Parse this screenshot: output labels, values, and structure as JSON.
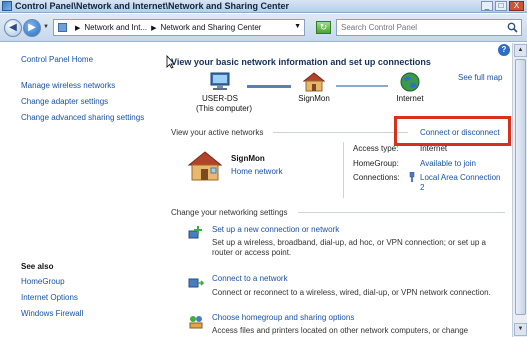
{
  "window": {
    "title": "Control Panel\\Network and Internet\\Network and Sharing Center",
    "buttons": {
      "minimize": "_",
      "maximize": "□",
      "close": "X"
    }
  },
  "address": {
    "crumbs": [
      "Network and Int...",
      "Network and Sharing Center"
    ],
    "search_placeholder": "Search Control Panel"
  },
  "sidebar": {
    "home": "Control Panel Home",
    "tasks": [
      "Manage wireless networks",
      "Change adapter settings",
      "Change advanced sharing settings"
    ],
    "see_also_header": "See also",
    "see_also": [
      "HomeGroup",
      "Internet Options",
      "Windows Firewall"
    ]
  },
  "main": {
    "heading": "View your basic network information and set up connections",
    "see_full_map": "See full map",
    "map_nodes": [
      {
        "name": "USER-DS",
        "sub": "(This computer)"
      },
      {
        "name": "SignMon",
        "sub": ""
      },
      {
        "name": "Internet",
        "sub": ""
      }
    ],
    "active_header": "View your active networks",
    "connect_disconnect": "Connect or disconnect",
    "network": {
      "name": "SignMon",
      "type": "Home network",
      "access_type_label": "Access type:",
      "access_type_value": "Internet",
      "homegroup_label": "HomeGroup:",
      "homegroup_value": "Available to join",
      "connections_label": "Connections:",
      "connections_value_1": "Local Area Connection",
      "connections_value_2": "2"
    },
    "change_header": "Change your networking settings",
    "tasks": [
      {
        "title": "Set up a new connection or network",
        "desc": "Set up a wireless, broadband, dial-up, ad hoc, or VPN connection; or set up a router or access point."
      },
      {
        "title": "Connect to a network",
        "desc": "Connect or reconnect to a wireless, wired, dial-up, or VPN network connection."
      },
      {
        "title": "Choose homegroup and sharing options",
        "desc": "Access files and printers located on other network computers, or change"
      }
    ]
  },
  "colors": {
    "link": "#1a52a8",
    "highlight_box": "#d8301c"
  }
}
